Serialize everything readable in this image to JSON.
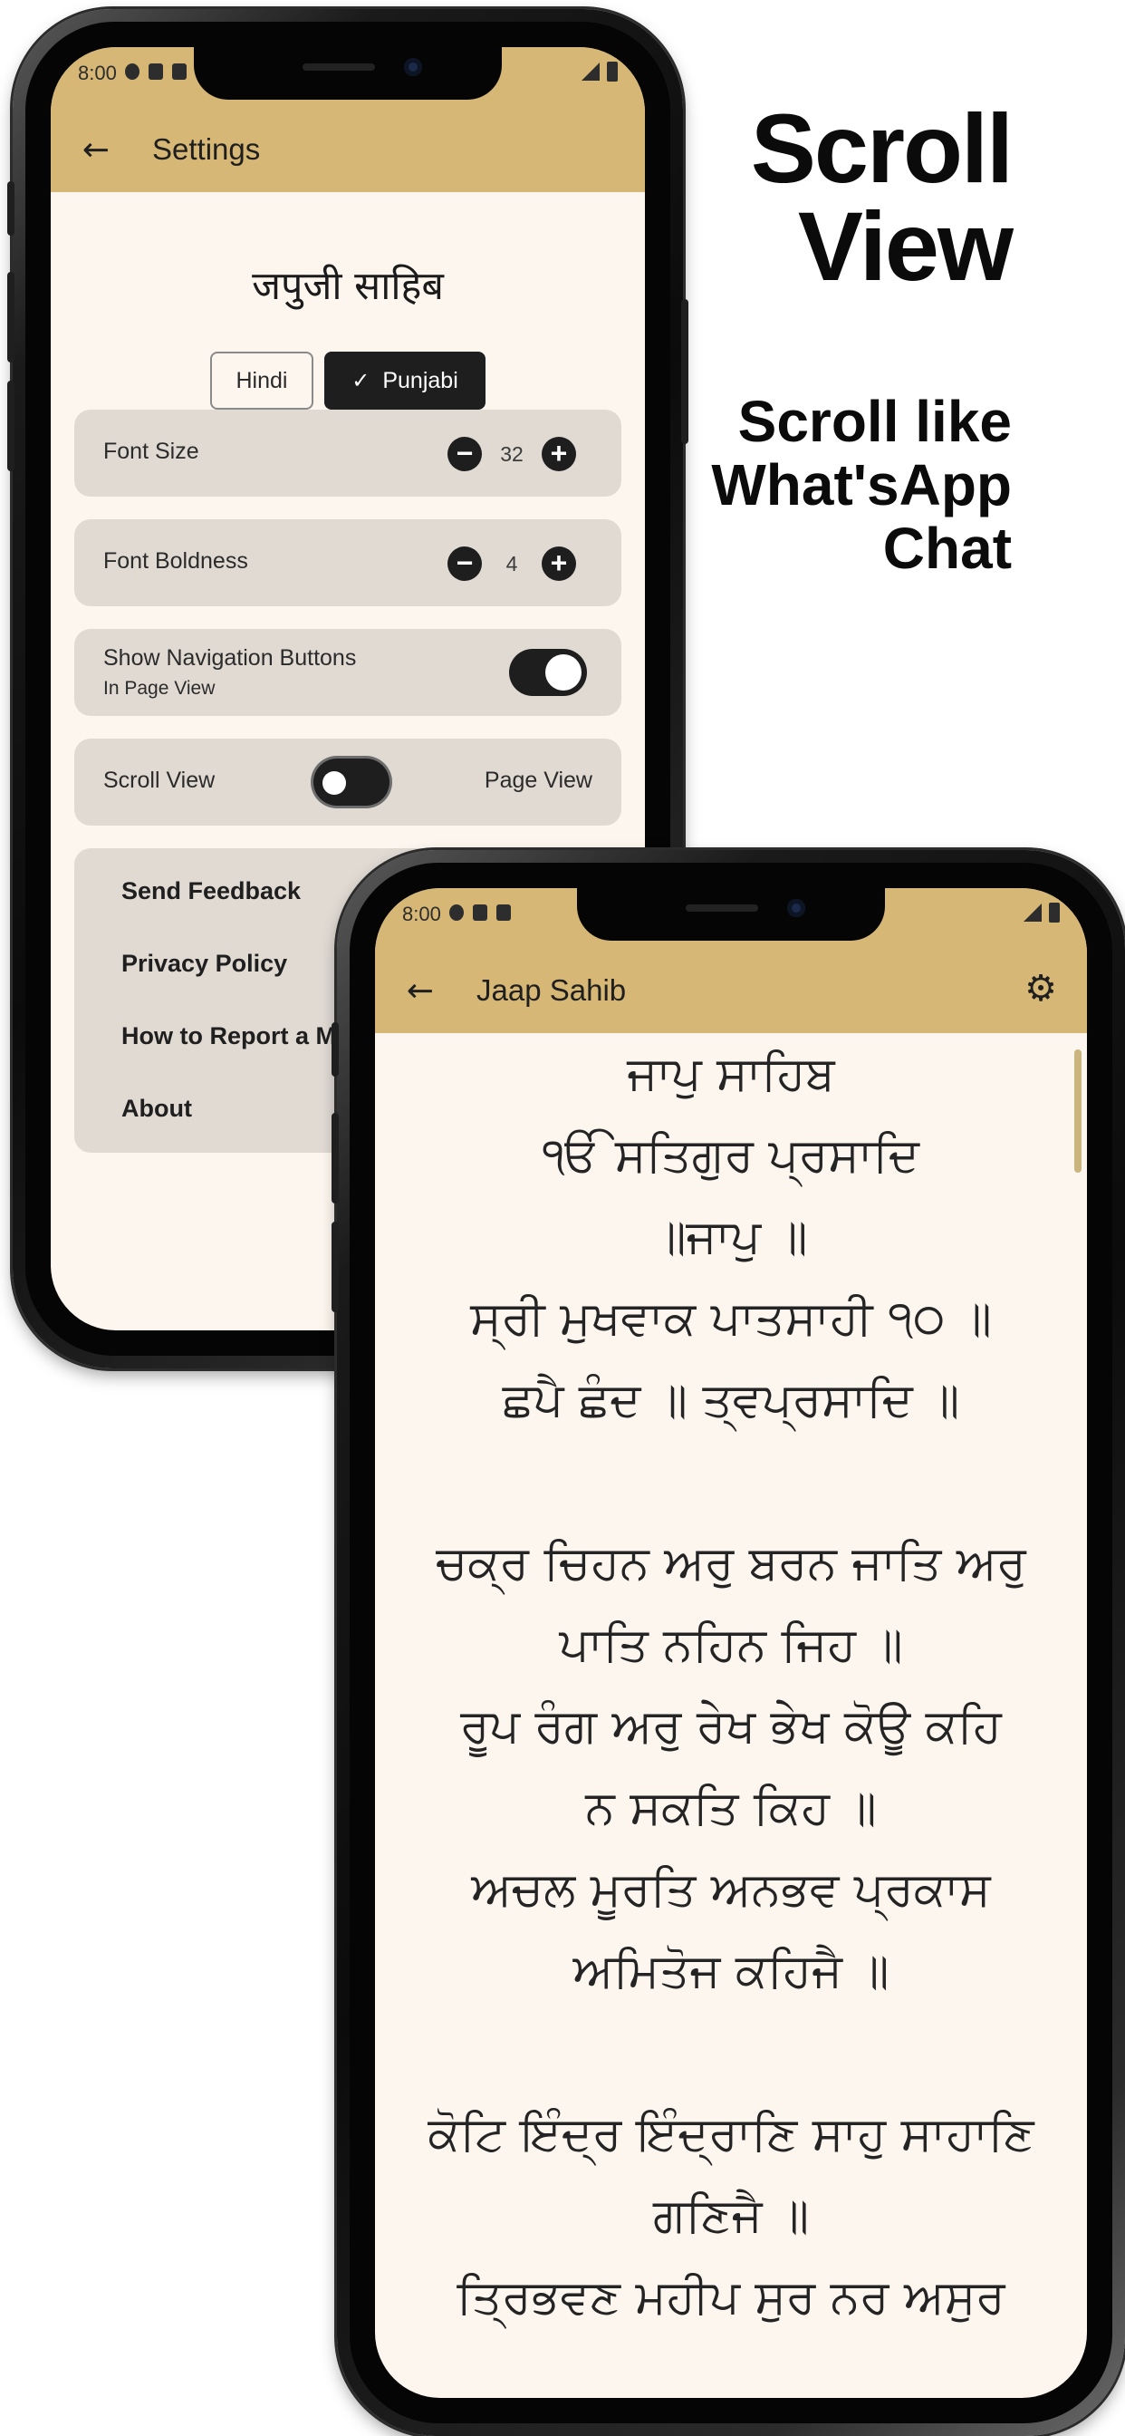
{
  "promo": {
    "headline_line1": "Scroll",
    "headline_line2": "View",
    "sub_line1": "Scroll like",
    "sub_line2": "What'sApp",
    "sub_line3": "Chat"
  },
  "status_bar": {
    "time": "8:00"
  },
  "settings_screen": {
    "app_bar_title": "Settings",
    "heading": "जपुजी साहिब",
    "language_options": [
      {
        "label": "Hindi",
        "selected": false
      },
      {
        "label": "Punjabi",
        "selected": true
      }
    ],
    "font_size": {
      "label": "Font Size",
      "value": "32",
      "minus": "−",
      "plus": "+"
    },
    "font_boldness": {
      "label": "Font Boldness",
      "value": "4",
      "minus": "−",
      "plus": "+"
    },
    "navigation_buttons": {
      "label": "Show Navigation Buttons",
      "sublabel": "In Page View",
      "enabled": true
    },
    "view_mode": {
      "left_label": "Scroll View",
      "right_label": "Page View",
      "page_view_selected": false
    },
    "links": [
      "Send Feedback",
      "Privacy Policy",
      "How to Report a Mis",
      "About"
    ]
  },
  "reader_screen": {
    "app_bar_title": "Jaap Sahib",
    "lines": [
      "ਜਾਪੁ ਸਾਹਿਬ",
      "ੴ ਸਤਿਗੁਰ ਪ੍ਰਸਾਦਿ",
      "॥ਜਾਪੁ ॥",
      "ਸ੍ਰੀ ਮੁਖਵਾਕ ਪਾਤਸਾਹੀ ੧੦ ॥",
      "ਛਪੈ ਛੰਦ ॥ ਤ੍ਵਪ੍ਰਸਾਦਿ ॥",
      "",
      "ਚਕ੍ਰ ਚਿਹਨ ਅਰੁ ਬਰਨ ਜਾਤਿ ਅਰੁ",
      "ਪਾਤਿ ਨਹਿਨ ਜਿਹ ॥",
      "ਰੂਪ ਰੰਗ ਅਰੁ ਰੇਖ ਭੇਖ ਕੋਊ ਕਹਿ",
      "ਨ ਸਕਤਿ ਕਿਹ ॥",
      "ਅਚਲ ਮੂਰਤਿ ਅਨਭਵ ਪ੍ਰਕਾਸ",
      "ਅਮਿਤੋਜ ਕਹਿਜੈ ॥",
      "",
      "ਕੋਟਿ ਇੰਦ੍ਰ ਇੰਦ੍ਰਾਣਿ ਸਾਹੁ ਸਾਹਾਣਿ",
      "ਗਣਿਜੈ ॥",
      "ਤ੍ਰਿਭਵਣ ਮਹੀਪ ਸੁਰ ਨਰ ਅਸੁਰ"
    ]
  },
  "colors": {
    "app_bar": "#d6b775",
    "background": "#fdf6ef",
    "card": "#e0dad3",
    "accent_dark": "#1e1e1e"
  },
  "icons": {
    "back": "arrow-left",
    "settings": "gear",
    "check": "checkmark",
    "minus": "minus-circle",
    "plus": "plus-circle"
  }
}
